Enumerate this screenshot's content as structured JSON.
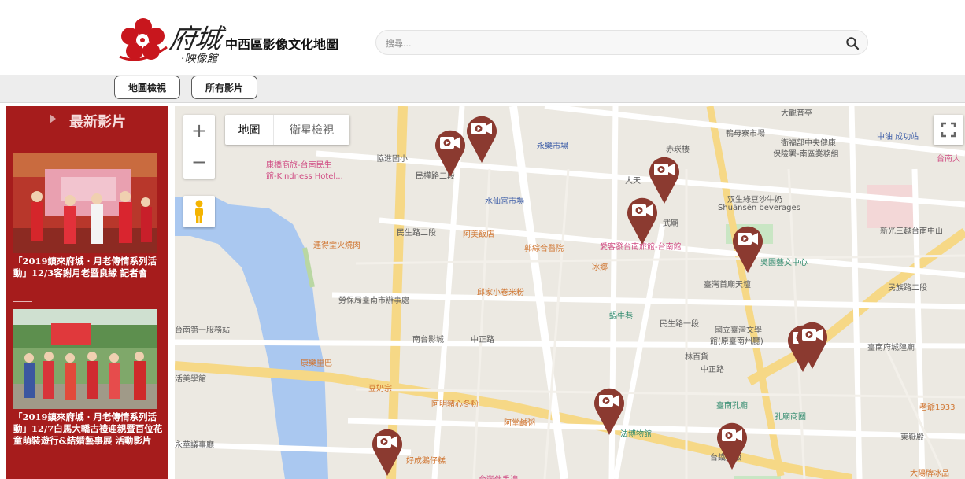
{
  "site": {
    "logo_script": "府城",
    "logo_sub": "·映像館",
    "logo_title": "中西區影像文化地圖"
  },
  "search": {
    "placeholder": "搜尋..."
  },
  "nav": {
    "map_view_label": "地圖檢視",
    "all_videos_label": "所有影片"
  },
  "sidebar": {
    "title": "最新影片",
    "videos": [
      {
        "caption": "「2019鎮來府城 · 月老傳情系列活動」12/3客謝月老暨良緣 記者會"
      },
      {
        "caption": "「2019鎮來府城 · 月老傳情系列活動」12/7白馬大轎古禮迎親暨百位花童萌裝遊行&結婚藝事展 活動影片"
      }
    ]
  },
  "map": {
    "zoom_in": "+",
    "zoom_out": "−",
    "type_map": "地圖",
    "type_satellite": "衛星檢視",
    "labels": {
      "l01": "大觀音亭",
      "l02": "鴨母寮市場",
      "l03": "衛福部中央健康",
      "l04": "保險署-南區業務組",
      "l05": "中油 成功站",
      "l06": "台南大",
      "l07": "永樂市場",
      "l08": "赤崁樓",
      "l09": "協進國小",
      "l10": "康橋商旅-台南民生",
      "l11": "館-Kindness Hotel...",
      "l12": "民權路二段",
      "l13": "水仙宮市場",
      "l14": "大天",
      "l15": "双生綠豆沙牛奶",
      "l16": "Shuānsēn beverages",
      "l17": "新光三越台南中山",
      "l18": "武廟",
      "l19": "民生路二段",
      "l20": "連得堂火燒肉",
      "l21": "阿美飯店",
      "l22": "郭綜合醫院",
      "l23": "愛客發台南旅館-台南館",
      "l24": "吳園藝文中心",
      "l25": "民族路二段",
      "l26": "冰鄉",
      "l27": "臺灣首廟天壇",
      "l28": "邱家小卷米粉",
      "l29": "勞保局臺南市辦事處",
      "l30": "蝸牛巷",
      "l31": "民生路一段",
      "l32": "國立臺灣文學",
      "l33": "館(原臺南州廳)",
      "l34": "臺南府城隍廟",
      "l35": "南台影城",
      "l36": "中正路",
      "l37": "林百貨",
      "l38": "中正路",
      "l39": "台南第一服務站",
      "l40": "康樂里巴",
      "l41": "活美學館",
      "l42": "豆奶宗",
      "l43": "阿明豬心冬粉",
      "l44": "阿堂鹹粥",
      "l45": "臺南孔廟",
      "l46": "孔廟商圈",
      "l47": "老爺1933",
      "l48": "東嶽殿",
      "l49": "永華議事廳",
      "l50": "好成鵝仔糕",
      "l51": "法博物館",
      "l52": "台灣伴手禮",
      "l53": "大陽牌冰品",
      "l54": "台鐵大飯"
    }
  }
}
